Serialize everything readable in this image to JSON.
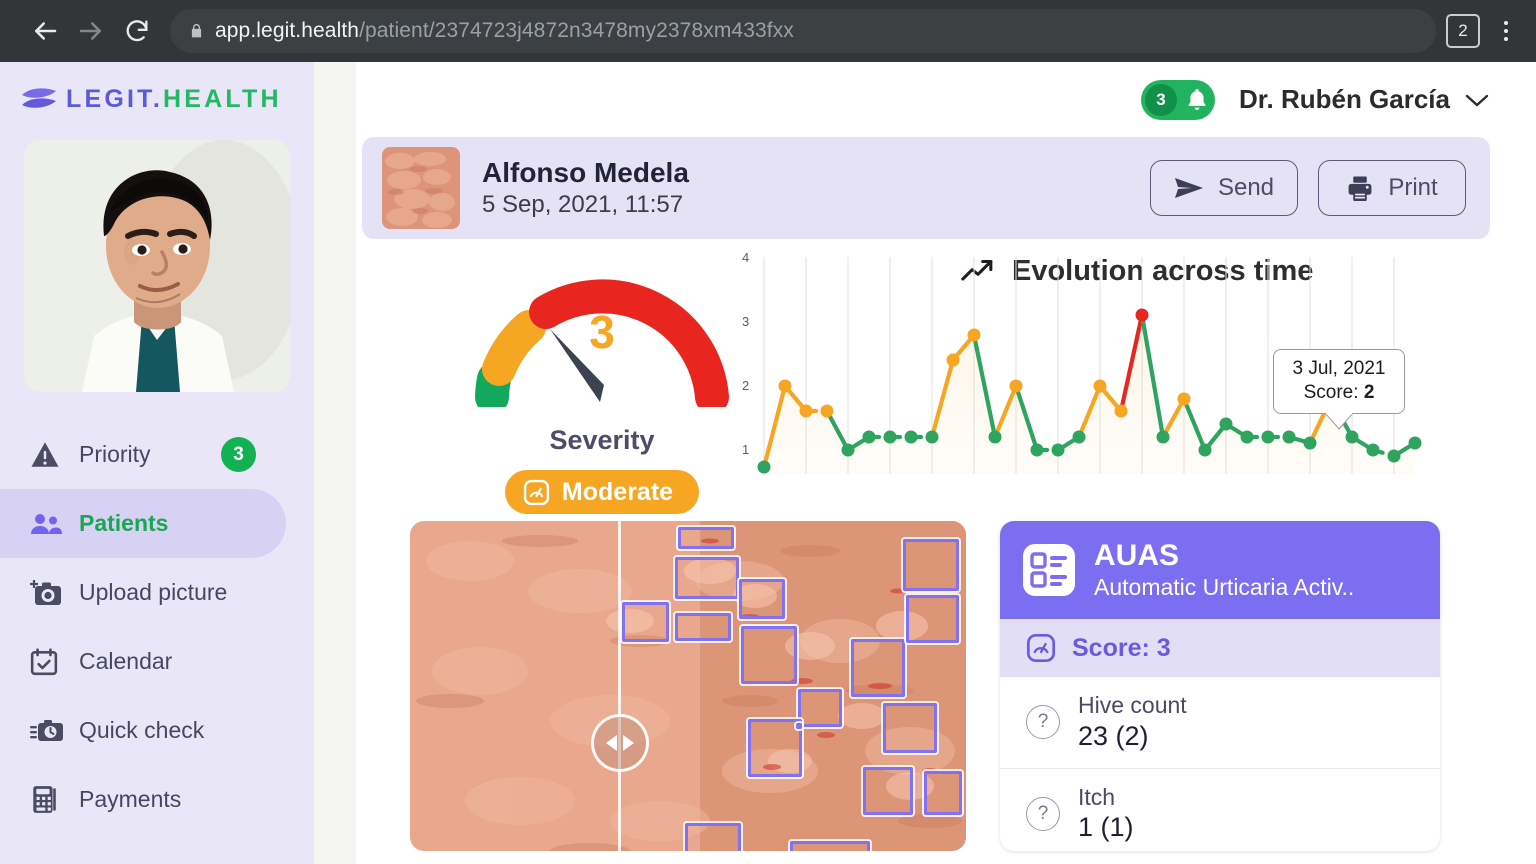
{
  "browser": {
    "url_host": "app.legit.health",
    "url_path": "/patient/2374723j4872n3478my2378xm433fxx",
    "tab_count": "2",
    "back_icon": "arrow-left-icon",
    "forward_icon": "arrow-right-icon",
    "reload_icon": "reload-icon",
    "lock_icon": "lock-icon",
    "menu_icon": "kebab-menu-icon"
  },
  "sidebar": {
    "logo": {
      "part_a": "LEGIT.",
      "part_b": "HEALTH"
    },
    "items": [
      {
        "label": "Priority",
        "icon": "warning-triangle-icon",
        "badge": "3",
        "active": false
      },
      {
        "label": "Patients",
        "icon": "people-icon",
        "badge": "",
        "active": true
      },
      {
        "label": "Upload picture",
        "icon": "camera-plus-icon",
        "badge": "",
        "active": false
      },
      {
        "label": "Calendar",
        "icon": "calendar-check-icon",
        "badge": "",
        "active": false
      },
      {
        "label": "Quick check",
        "icon": "camera-clock-icon",
        "badge": "",
        "active": false
      },
      {
        "label": "Payments",
        "icon": "calculator-icon",
        "badge": "",
        "active": false
      }
    ]
  },
  "topbar": {
    "notification_count": "3",
    "bell_icon": "bell-icon",
    "doctor_name": "Dr. Rubén García",
    "caret_icon": "chevron-down-icon"
  },
  "patient": {
    "name": "Alfonso Medela",
    "date": "5 Sep, 2021, 11:57",
    "send_label": "Send",
    "send_icon": "send-icon",
    "print_label": "Print",
    "print_icon": "printer-icon"
  },
  "gauge": {
    "value": "3",
    "label": "Severity",
    "severity_label": "Moderate",
    "severity_icon": "speedometer-icon",
    "colors": {
      "low": "#1aa85a",
      "moderate": "#f5a623",
      "high": "#e8251f",
      "needle": "#3c4250"
    }
  },
  "chart_data": {
    "type": "line",
    "title": "Evolution across time",
    "title_icon": "trend-up-icon",
    "xlabel": "",
    "ylabel": "",
    "ylim": [
      0,
      4
    ],
    "yticks": [
      "1",
      "2",
      "3",
      "4"
    ],
    "grid": true,
    "legend": "none",
    "point_colors": {
      "green": "#2ea45f",
      "orange": "#f5a623",
      "red": "#e8251f"
    },
    "x": [
      0,
      1,
      2,
      3,
      4,
      5,
      6,
      7,
      8,
      9,
      10,
      11,
      12,
      13,
      14,
      15,
      16,
      17,
      18,
      19,
      20,
      21,
      22,
      23,
      24,
      25,
      26,
      27,
      28,
      29,
      30,
      31
    ],
    "values": [
      0.8,
      2.0,
      1.6,
      1.6,
      1.0,
      1.2,
      1.2,
      1.2,
      1.2,
      2.4,
      2.8,
      1.2,
      2.0,
      1.0,
      1.0,
      1.2,
      2.0,
      1.6,
      3.1,
      1.2,
      1.7,
      1.0,
      1.4,
      1.2,
      1.2,
      1.2,
      1.1,
      1.7,
      1.2,
      1.0,
      0.9,
      1.1
    ],
    "colors": [
      "green",
      "orange",
      "orange",
      "orange",
      "green",
      "green",
      "green",
      "green",
      "green",
      "orange",
      "orange",
      "green",
      "orange",
      "green",
      "green",
      "green",
      "orange",
      "orange",
      "red",
      "green",
      "orange",
      "green",
      "green",
      "green",
      "green",
      "green",
      "green",
      "orange",
      "green",
      "green",
      "green",
      "green"
    ],
    "tooltip": {
      "date": "3 Jul, 2021",
      "score_label": "Score:",
      "score_value": "2"
    }
  },
  "image_panel": {
    "slider_icon": "left-right-arrows-icon",
    "lesion_boxes": 20
  },
  "auas": {
    "icon": "list-checklist-icon",
    "title": "AUAS",
    "subtitle": "Automatic Urticaria Activ..",
    "score_icon": "speedometer-icon",
    "score_text": "Score: 3",
    "items": [
      {
        "label": "Hive count",
        "value": "23 (2)",
        "help_icon": "question-mark-icon"
      },
      {
        "label": "Itch",
        "value": "1 (1)",
        "help_icon": "question-mark-icon"
      }
    ]
  }
}
